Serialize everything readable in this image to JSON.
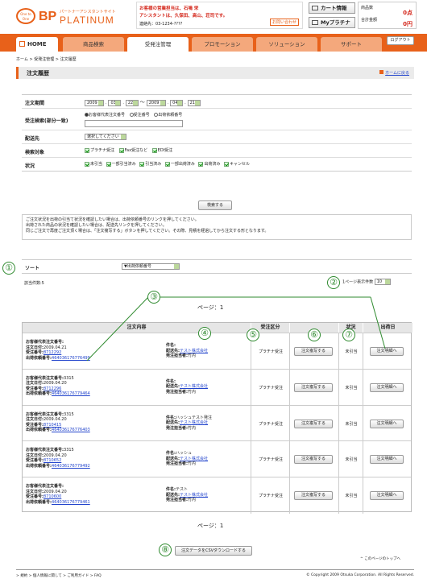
{
  "header": {
    "logo_small": "One to One",
    "logo_bp": "BP",
    "logo_sub": "パートナーアシスタントサイト",
    "logo_platinum": "PLATINUM",
    "notice_line1": "お客様の営業担当は、石鳴 栄",
    "notice_line2": "アシスタントは、久保田、高山、荘司です。",
    "contact": "連絡先：03-1234-????",
    "inquiry_button": "お問い合わせ",
    "cart_button": "カート情報",
    "myplatinum_button": "Myプラチナ",
    "product_count_label": "商品数",
    "product_count_value": "0点",
    "total_label": "合計金額",
    "total_value": "0円",
    "logout_button": "ログアウト"
  },
  "nav": [
    "HOME",
    "商品検索",
    "受発注管理",
    "プロモーション",
    "ソリューション",
    "サポート"
  ],
  "breadcrumb": "ホーム > 受発注管理 > 注文履歴",
  "page_title": "注文履歴",
  "back_link": "ホームに戻る",
  "form": {
    "period_label": "注文期間",
    "period_from": {
      "year": "2009",
      "month": "03",
      "day": "22"
    },
    "period_to": {
      "year": "2009",
      "month": "04",
      "day": "21"
    },
    "period_sep": "〜",
    "search_label": "受注検索(部分一致)",
    "radio_options": [
      "お客様代表注文番号",
      "受注番号",
      "出荷依頼番号"
    ],
    "delivery_label": "配送先",
    "delivery_value": "選択してください",
    "target_label": "検索対象",
    "target_options": [
      "プラチナ受注",
      "Fax受注など",
      "EDI受注"
    ],
    "status_label": "状況",
    "status_options": [
      "未引当",
      "一部引当済み",
      "引当済み",
      "一部出荷済み",
      "出荷済み",
      "キャンセル"
    ],
    "search_button": "検索する"
  },
  "info_lines": [
    "ご注文状況を出荷の引当て状況を確認したい場合は、出荷依頼番号のリンクを押してください。",
    "出荷された商品の状況を確認したい場合は、配送先リンクを押してください。",
    "同じご注文で再度ご注文頂く場合は、「注文複写する」ボタンを押してください。その際、見積を経過してから注文する形となります。"
  ],
  "sort": {
    "label": "ソート",
    "value": "▼出荷依頼番号"
  },
  "result_count": "該当件数:5",
  "per_page": {
    "label": "1ページ表示件数",
    "value": "10"
  },
  "page_label": "ページ：1",
  "table_headers": [
    "注文内容",
    "受注区分",
    "状況",
    "出荷日"
  ],
  "labels": {
    "order_no": "お客様代表注文番号:",
    "order_date": "注文日付:",
    "receipt_no": "受注番号:",
    "ship_no": "出荷依頼番号:",
    "item": "件名:",
    "delivery": "配送先:",
    "staff": "発注担当者:"
  },
  "orders": [
    {
      "order_no": "",
      "order_date": "2009.04.21",
      "receipt_no": "8712292",
      "ship_no": "464036176776499",
      "item": "",
      "delivery": "テスト株式会社",
      "staff": "竹内",
      "type": "プラチナ受注",
      "copy_btn": "注文複写する",
      "status": "未引当",
      "detail_btn": "注文明細へ"
    },
    {
      "order_no": "3315",
      "order_date": "2009.04.20",
      "receipt_no": "8712296",
      "ship_no": "464036176779464",
      "item": "",
      "delivery": "テスト株式会社",
      "staff": "竹内",
      "type": "プラチナ受注",
      "copy_btn": "注文複写する",
      "status": "未引当",
      "detail_btn": "注文明細へ"
    },
    {
      "order_no": "3315",
      "order_date": "2009.04.20",
      "receipt_no": "8710415",
      "ship_no": "464036176776403",
      "item": "ハッシュテスト発注",
      "delivery": "テスト株式会社",
      "staff": "竹内",
      "type": "プラチナ受注",
      "copy_btn": "注文複写する",
      "status": "未引当",
      "detail_btn": "注文明細へ"
    },
    {
      "order_no": "3315",
      "order_date": "2009.04.20",
      "receipt_no": "8710652",
      "ship_no": "464036176779492",
      "item": "ハッシュ",
      "delivery": "テスト株式会社",
      "staff": "竹内",
      "type": "プラチナ受注",
      "copy_btn": "注文複写する",
      "status": "未引当",
      "detail_btn": "注文明細へ"
    },
    {
      "order_no": "",
      "order_date": "2009.04.20",
      "receipt_no": "8710600",
      "ship_no": "464036176779461",
      "item": "テスト",
      "delivery": "テスト株式会社",
      "staff": "竹内",
      "type": "プラチナ受注",
      "copy_btn": "注文複写する",
      "status": "未引当",
      "detail_btn": "注文明細へ"
    }
  ],
  "csv_button": "注文データをCSVダウンロードする",
  "page_top": "このページのトップへ",
  "footer_links": [
    "規約",
    "個人情報に関して",
    "ご利用ガイド",
    "FAQ"
  ],
  "copyright": "© Copyright 2009 Otsuka Corporation. All Rights Reserved.",
  "markers": [
    "①",
    "②",
    "③",
    "④",
    "⑤",
    "⑥",
    "⑦",
    "⑧"
  ],
  "colors": {
    "nav": "#e8611a",
    "accent": "#e8611a",
    "marker": "#2f8a2f"
  }
}
